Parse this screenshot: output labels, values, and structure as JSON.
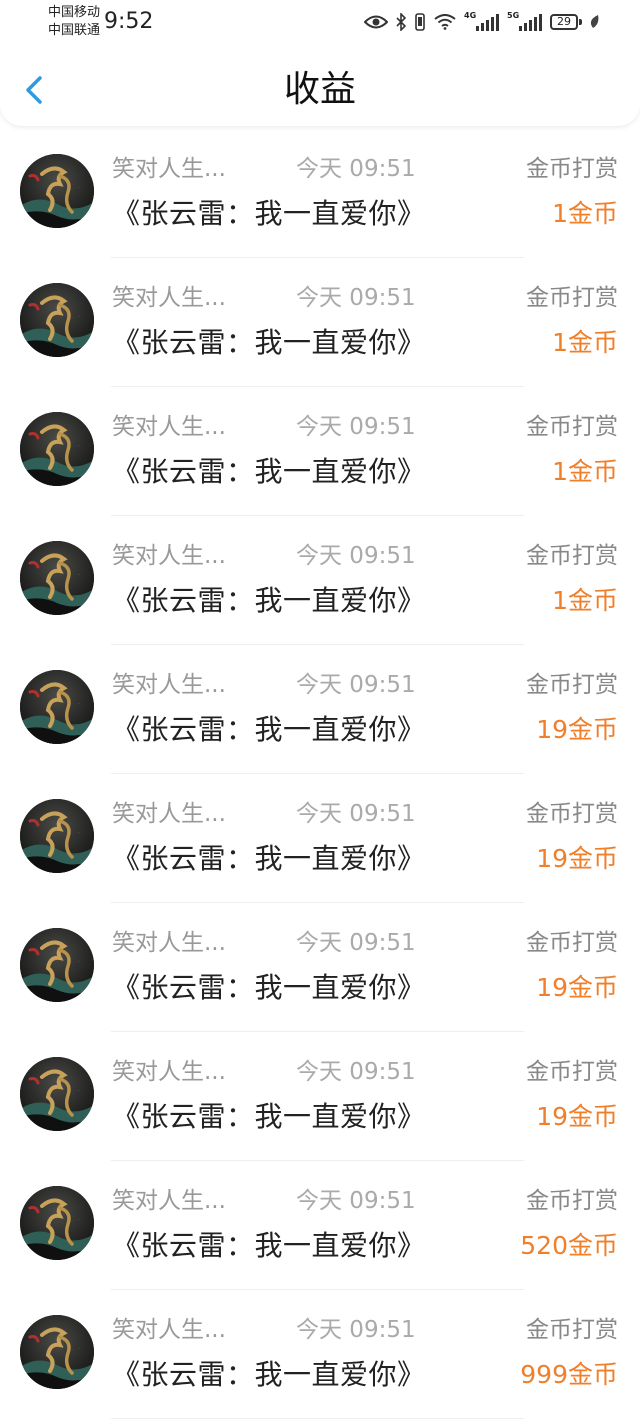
{
  "status_bar": {
    "carrier_1": "中国移动",
    "carrier_2": "中国联通",
    "time": "9:52",
    "signal_1_label": "4G",
    "signal_2_label": "5G",
    "battery": "29",
    "icons": [
      "eye-icon",
      "bluetooth-icon",
      "vibrate-icon",
      "wifi-icon",
      "signal-icon",
      "signal-icon",
      "battery-icon",
      "leaf-icon"
    ]
  },
  "header": {
    "title": "收益",
    "back_icon": "chevron-left-icon"
  },
  "colors": {
    "accent_back": "#2f9ae0",
    "amount": "#f07f2a"
  },
  "records": [
    {
      "nickname": "笑对人生...",
      "time": "今天 09:51",
      "type": "金币打赏",
      "work": "《张云雷：我一直爱你》",
      "amount": "1金币"
    },
    {
      "nickname": "笑对人生...",
      "time": "今天 09:51",
      "type": "金币打赏",
      "work": "《张云雷：我一直爱你》",
      "amount": "1金币"
    },
    {
      "nickname": "笑对人生...",
      "time": "今天 09:51",
      "type": "金币打赏",
      "work": "《张云雷：我一直爱你》",
      "amount": "1金币"
    },
    {
      "nickname": "笑对人生...",
      "time": "今天 09:51",
      "type": "金币打赏",
      "work": "《张云雷：我一直爱你》",
      "amount": "1金币"
    },
    {
      "nickname": "笑对人生...",
      "time": "今天 09:51",
      "type": "金币打赏",
      "work": "《张云雷：我一直爱你》",
      "amount": "19金币"
    },
    {
      "nickname": "笑对人生...",
      "time": "今天 09:51",
      "type": "金币打赏",
      "work": "《张云雷：我一直爱你》",
      "amount": "19金币"
    },
    {
      "nickname": "笑对人生...",
      "time": "今天 09:51",
      "type": "金币打赏",
      "work": "《张云雷：我一直爱你》",
      "amount": "19金币"
    },
    {
      "nickname": "笑对人生...",
      "time": "今天 09:51",
      "type": "金币打赏",
      "work": "《张云雷：我一直爱你》",
      "amount": "19金币"
    },
    {
      "nickname": "笑对人生...",
      "time": "今天 09:51",
      "type": "金币打赏",
      "work": "《张云雷：我一直爱你》",
      "amount": "520金币"
    },
    {
      "nickname": "笑对人生...",
      "time": "今天 09:51",
      "type": "金币打赏",
      "work": "《张云雷：我一直爱你》",
      "amount": "999金币"
    }
  ]
}
